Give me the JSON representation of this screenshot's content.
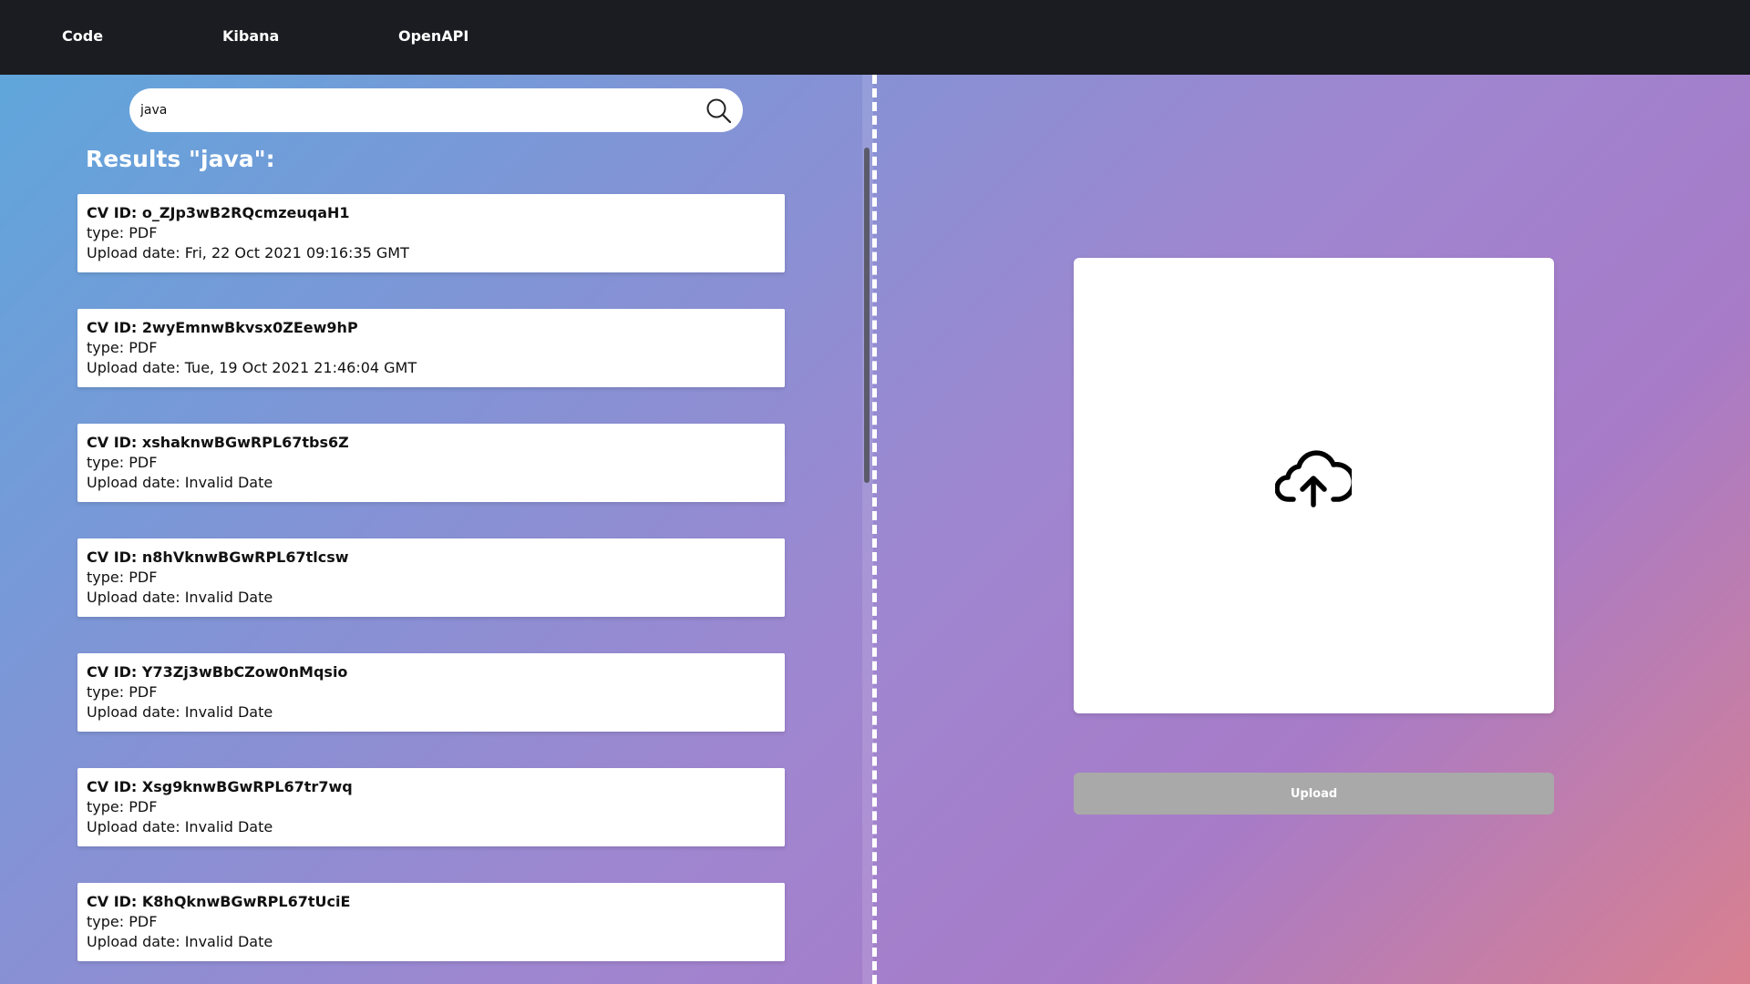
{
  "nav": {
    "items": [
      {
        "label": "Code"
      },
      {
        "label": "Kibana"
      },
      {
        "label": "OpenAPI"
      }
    ]
  },
  "search": {
    "value": "java",
    "icon": "search-icon"
  },
  "results": {
    "title": "Results \"java\":",
    "items": [
      {
        "id": "CV ID: o_ZJp3wB2RQcmzeuqaH1",
        "type": "type: PDF",
        "date": "Upload date: Fri, 22 Oct 2021 09:16:35 GMT"
      },
      {
        "id": "CV ID: 2wyEmnwBkvsx0ZEew9hP",
        "type": "type: PDF",
        "date": "Upload date: Tue, 19 Oct 2021 21:46:04 GMT"
      },
      {
        "id": "CV ID: xshaknwBGwRPL67tbs6Z",
        "type": "type: PDF",
        "date": "Upload date: Invalid Date"
      },
      {
        "id": "CV ID: n8hVknwBGwRPL67tlcsw",
        "type": "type: PDF",
        "date": "Upload date: Invalid Date"
      },
      {
        "id": "CV ID: Y73Zj3wBbCZow0nMqsio",
        "type": "type: PDF",
        "date": "Upload date: Invalid Date"
      },
      {
        "id": "CV ID: Xsg9knwBGwRPL67tr7wq",
        "type": "type: PDF",
        "date": "Upload date: Invalid Date"
      },
      {
        "id": "CV ID: K8hQknwBGwRPL67tUciE",
        "type": "type: PDF",
        "date": "Upload date: Invalid Date"
      }
    ]
  },
  "upload": {
    "icon": "cloud-upload-icon",
    "button_label": "Upload"
  },
  "colors": {
    "topbar": "#1b1c21",
    "upload_button": "#a9a9a9",
    "card": "#ffffff"
  }
}
